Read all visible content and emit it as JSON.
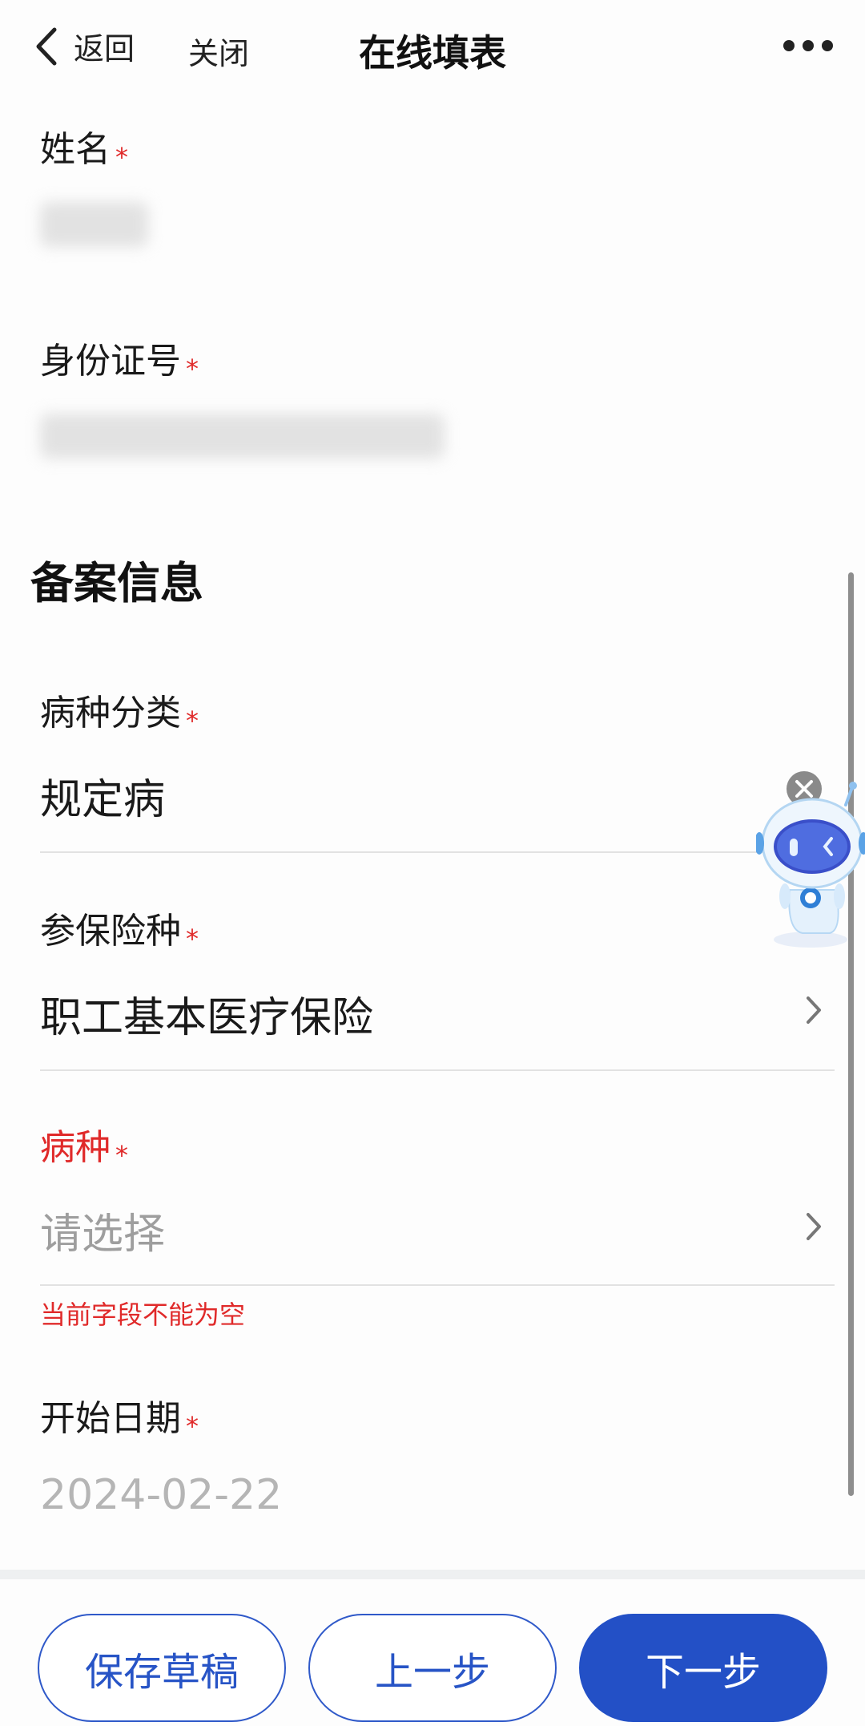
{
  "header": {
    "back_label": "返回",
    "close_label": "关闭",
    "title": "在线填表"
  },
  "fields": {
    "name": {
      "label": "姓名",
      "required_mark": "*"
    },
    "id_number": {
      "label": "身份证号",
      "required_mark": "*"
    },
    "disease_category": {
      "label": "病种分类",
      "required_mark": "*",
      "value": "规定病"
    },
    "insurance_type": {
      "label": "参保险种",
      "required_mark": "*",
      "value": "职工基本医疗保险"
    },
    "disease": {
      "label": "病种",
      "required_mark": "*",
      "placeholder": "请选择",
      "error": "当前字段不能为空"
    },
    "start_date": {
      "label": "开始日期",
      "required_mark": "*",
      "value": "2024-02-22"
    }
  },
  "section": {
    "title": "备案信息"
  },
  "buttons": {
    "save_draft": "保存草稿",
    "prev": "上一步",
    "next": "下一步"
  },
  "colors": {
    "primary": "#2350c6",
    "error": "#e02a2a",
    "required": "#e02a2a"
  }
}
